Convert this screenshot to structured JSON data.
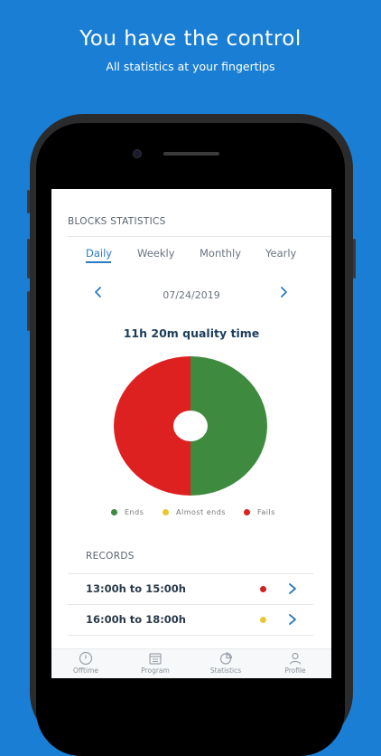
{
  "hero": {
    "title": "You have the control",
    "subtitle": "All statistics at your fingertips"
  },
  "screen": {
    "header_title": "BLOCKS STATISTICS",
    "tabs": [
      {
        "label": "Daily",
        "active": true
      },
      {
        "label": "Weekly",
        "active": false
      },
      {
        "label": "Monthly",
        "active": false
      },
      {
        "label": "Yearly",
        "active": false
      }
    ],
    "date": "07/24/2019",
    "quality_time": "11h 20m quality time",
    "chart_data": {
      "type": "pie",
      "categories": [
        "Ends",
        "Almost ends",
        "Fails"
      ],
      "values": [
        50,
        0,
        50
      ],
      "colors": [
        "#3e8a3e",
        "#e8c832",
        "#dd2020"
      ],
      "legend_placement": "bottom"
    },
    "legend": [
      {
        "label": "Ends",
        "color": "#3e8a3e"
      },
      {
        "label": "Almost ends",
        "color": "#e8c832"
      },
      {
        "label": "Fails",
        "color": "#dd2020"
      }
    ],
    "records_title": "RECORDS",
    "records": [
      {
        "time": "13:00h to 15:00h",
        "status_color": "#cc2222"
      },
      {
        "time": "16:00h to 18:00h",
        "status_color": "#e8c832"
      }
    ],
    "bottom_nav": [
      {
        "label": "Offtime",
        "icon": "clock-icon"
      },
      {
        "label": "Program",
        "icon": "calendar-icon"
      },
      {
        "label": "Statistics",
        "icon": "pie-chart-icon"
      },
      {
        "label": "Profile",
        "icon": "user-icon"
      }
    ],
    "accent_color": "#2a7bc0"
  }
}
